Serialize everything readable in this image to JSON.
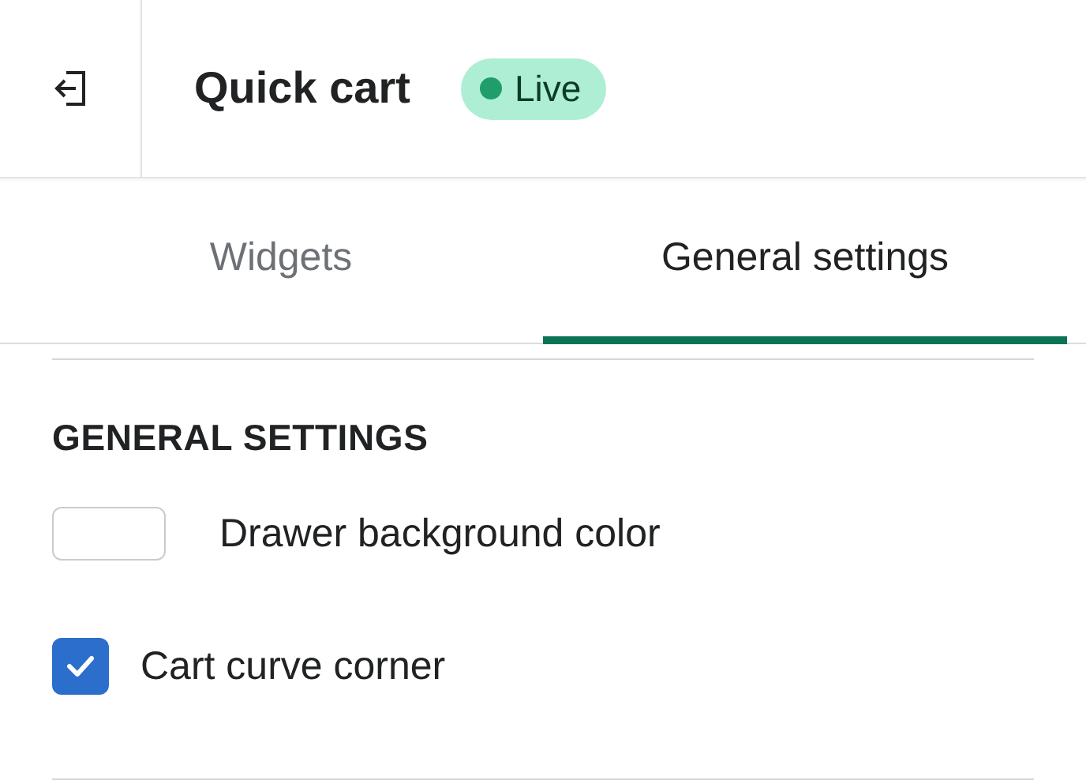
{
  "header": {
    "title": "Quick cart",
    "status": {
      "label": "Live",
      "color": "#1f9d6b"
    }
  },
  "tabs": [
    {
      "label": "Widgets",
      "selected": false
    },
    {
      "label": "General settings",
      "selected": true
    }
  ],
  "section": {
    "heading": "GENERAL SETTINGS",
    "settings": [
      {
        "kind": "color",
        "label": "Drawer background color",
        "color": "#ffffff"
      },
      {
        "kind": "checkbox",
        "label": "Cart curve corner",
        "checked": true
      }
    ]
  }
}
